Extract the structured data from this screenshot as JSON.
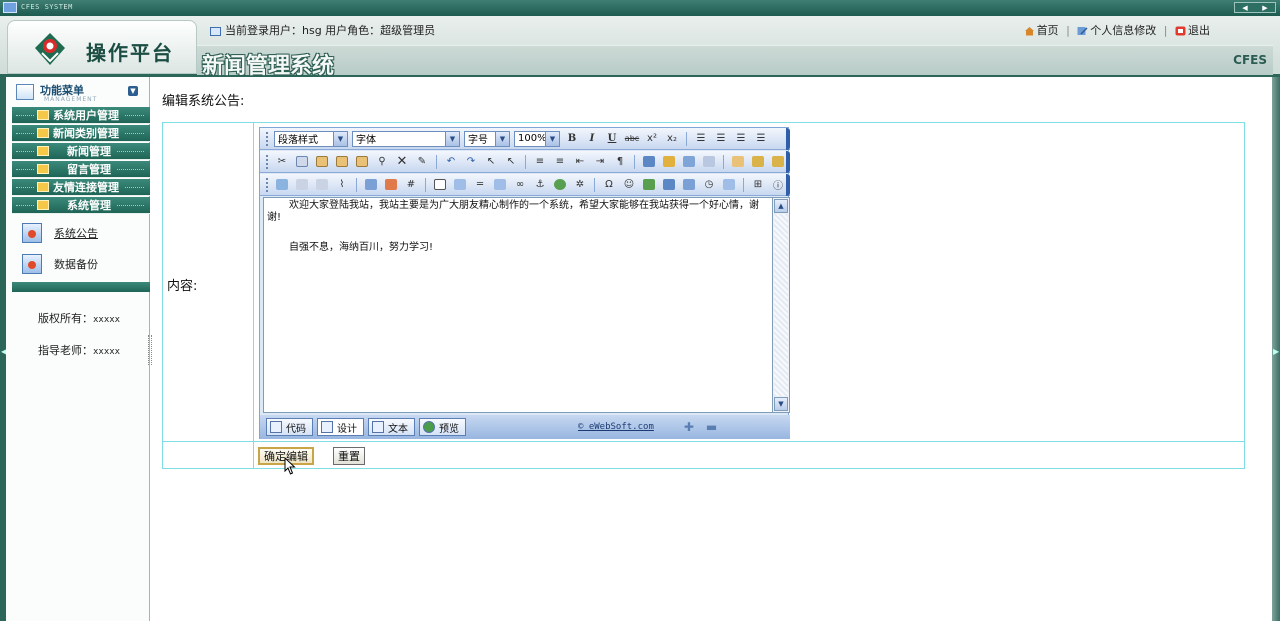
{
  "window": {
    "title": "CFES SYSTEM"
  },
  "header": {
    "logo_text": "操作平台",
    "user_info": "当前登录用户：hsg  用户角色：超级管理员",
    "system_name": "新闻管理系统",
    "brand": "CFES",
    "nav": {
      "home": "首页",
      "profile": "个人信息修改",
      "logout": "退出"
    }
  },
  "sidebar": {
    "menu_title": "功能菜单",
    "menu_subtitle": "MANAGEMENT",
    "items": [
      {
        "label": "系统用户管理"
      },
      {
        "label": "新闻类别管理"
      },
      {
        "label": "新闻管理"
      },
      {
        "label": "留言管理"
      },
      {
        "label": "友情连接管理"
      },
      {
        "label": "系统管理"
      }
    ],
    "sub_items": [
      {
        "label": "系统公告"
      },
      {
        "label": "数据备份"
      }
    ],
    "copyright_label": "版权所有：",
    "copyright_value": "xxxxx",
    "teacher_label": "指导老师：",
    "teacher_value": "xxxxx"
  },
  "main": {
    "page_title": "编辑系统公告:",
    "content_label": "内容:",
    "editor": {
      "paragraph_style": "段落样式",
      "font": "字体",
      "font_size": "字号",
      "zoom": "100%",
      "content": [
        "欢迎大家登陆我站，我站主要是为广大朋友精心制作的一个系统，希望大家能够在我站获得一个好心情，谢谢!",
        "自强不息，海纳百川，努力学习!"
      ],
      "modes": [
        "代码",
        "设计",
        "文本",
        "预览"
      ],
      "copyright": "© eWebSoft.com"
    },
    "buttons": {
      "confirm": "确定编辑",
      "reset": "重置"
    }
  }
}
